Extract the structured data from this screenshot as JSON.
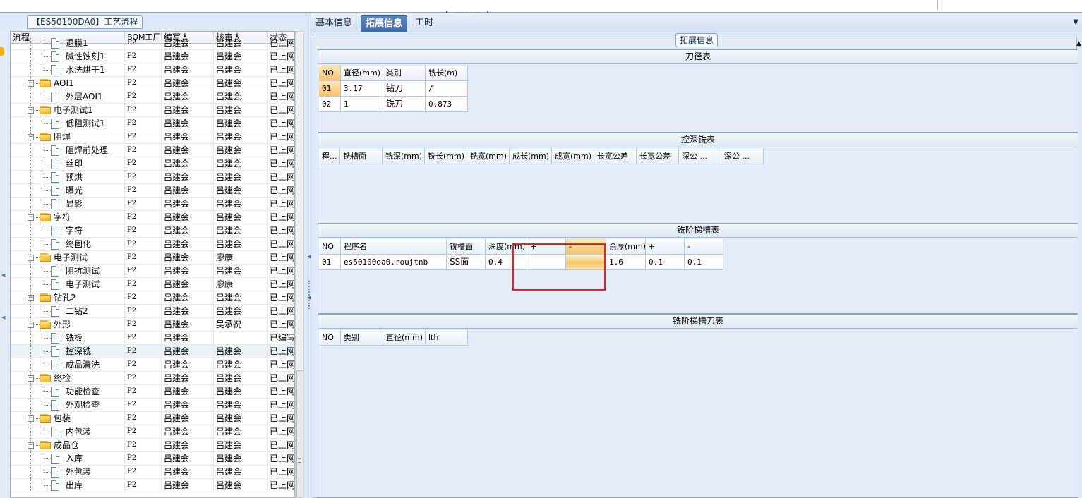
{
  "left_panel": {
    "title": "【ES50100DA0】工艺流程",
    "columns": [
      "流程",
      "BOM工厂",
      "编写人",
      "核审人",
      "状态"
    ],
    "rows": [
      {
        "level": 2,
        "type": "leaf",
        "name": "退膜1",
        "bom": "P2",
        "writer": "吕建会",
        "reviewer": "吕建会",
        "status": "已上网"
      },
      {
        "level": 2,
        "type": "leaf",
        "name": "碱性蚀刻1",
        "bom": "P2",
        "writer": "吕建会",
        "reviewer": "吕建会",
        "status": "已上网"
      },
      {
        "level": 2,
        "type": "leaf",
        "name": "水洗烘干1",
        "bom": "P2",
        "writer": "吕建会",
        "reviewer": "吕建会",
        "status": "已上网"
      },
      {
        "level": 1,
        "type": "folder",
        "name": "AOI1",
        "bom": "P2",
        "writer": "吕建会",
        "reviewer": "吕建会",
        "status": "已上网"
      },
      {
        "level": 2,
        "type": "leaf",
        "name": "外层AOI1",
        "bom": "P2",
        "writer": "吕建会",
        "reviewer": "吕建会",
        "status": "已上网"
      },
      {
        "level": 1,
        "type": "folder",
        "name": "电子测试1",
        "bom": "P2",
        "writer": "吕建会",
        "reviewer": "吕建会",
        "status": "已上网"
      },
      {
        "level": 2,
        "type": "leaf",
        "name": "低阻测试1",
        "bom": "P2",
        "writer": "吕建会",
        "reviewer": "吕建会",
        "status": "已上网"
      },
      {
        "level": 1,
        "type": "folder",
        "name": "阻焊",
        "bom": "P2",
        "writer": "吕建会",
        "reviewer": "吕建会",
        "status": "已上网"
      },
      {
        "level": 2,
        "type": "leaf",
        "name": "阻焊前处理",
        "bom": "P2",
        "writer": "吕建会",
        "reviewer": "吕建会",
        "status": "已上网"
      },
      {
        "level": 2,
        "type": "leaf",
        "name": "丝印",
        "bom": "P2",
        "writer": "吕建会",
        "reviewer": "吕建会",
        "status": "已上网"
      },
      {
        "level": 2,
        "type": "leaf",
        "name": "预烘",
        "bom": "P2",
        "writer": "吕建会",
        "reviewer": "吕建会",
        "status": "已上网"
      },
      {
        "level": 2,
        "type": "leaf",
        "name": "曝光",
        "bom": "P2",
        "writer": "吕建会",
        "reviewer": "吕建会",
        "status": "已上网"
      },
      {
        "level": 2,
        "type": "leaf",
        "name": "显影",
        "bom": "P2",
        "writer": "吕建会",
        "reviewer": "吕建会",
        "status": "已上网"
      },
      {
        "level": 1,
        "type": "folder",
        "name": "字符",
        "bom": "P2",
        "writer": "吕建会",
        "reviewer": "吕建会",
        "status": "已上网"
      },
      {
        "level": 2,
        "type": "leaf",
        "name": "字符",
        "bom": "P2",
        "writer": "吕建会",
        "reviewer": "吕建会",
        "status": "已上网"
      },
      {
        "level": 2,
        "type": "leaf",
        "name": "终固化",
        "bom": "P2",
        "writer": "吕建会",
        "reviewer": "吕建会",
        "status": "已上网"
      },
      {
        "level": 1,
        "type": "folder",
        "name": "电子测试",
        "bom": "P2",
        "writer": "吕建会",
        "reviewer": "廖康",
        "status": "已上网"
      },
      {
        "level": 2,
        "type": "leaf",
        "name": "阻抗测试",
        "bom": "P2",
        "writer": "吕建会",
        "reviewer": "吕建会",
        "status": "已上网"
      },
      {
        "level": 2,
        "type": "leaf",
        "name": "电子测试",
        "bom": "P2",
        "writer": "吕建会",
        "reviewer": "廖康",
        "status": "已上网"
      },
      {
        "level": 1,
        "type": "folder",
        "name": "钻孔2",
        "bom": "P2",
        "writer": "吕建会",
        "reviewer": "吕建会",
        "status": "已上网"
      },
      {
        "level": 2,
        "type": "leaf",
        "name": "二钻2",
        "bom": "P2",
        "writer": "吕建会",
        "reviewer": "吕建会",
        "status": "已上网"
      },
      {
        "level": 1,
        "type": "folder",
        "name": "外形",
        "bom": "P2",
        "writer": "吕建会",
        "reviewer": "吴承祝",
        "status": "已上网"
      },
      {
        "level": 2,
        "type": "leaf",
        "name": "铣板",
        "bom": "P2",
        "writer": "吕建会",
        "reviewer": "",
        "status": "已编写"
      },
      {
        "level": 2,
        "type": "leaf",
        "name": "控深铣",
        "bom": "P2",
        "writer": "吕建会",
        "reviewer": "吕建会",
        "status": "已上网",
        "selected": true
      },
      {
        "level": 2,
        "type": "leaf",
        "name": "成品清洗",
        "bom": "P2",
        "writer": "吕建会",
        "reviewer": "吕建会",
        "status": "已上网"
      },
      {
        "level": 1,
        "type": "folder",
        "name": "终检",
        "bom": "P2",
        "writer": "吕建会",
        "reviewer": "吕建会",
        "status": "已上网"
      },
      {
        "level": 2,
        "type": "leaf",
        "name": "功能检查",
        "bom": "P2",
        "writer": "吕建会",
        "reviewer": "吕建会",
        "status": "已上网"
      },
      {
        "level": 2,
        "type": "leaf",
        "name": "外观检查",
        "bom": "P2",
        "writer": "吕建会",
        "reviewer": "吕建会",
        "status": "已上网"
      },
      {
        "level": 1,
        "type": "folder",
        "name": "包装",
        "bom": "P2",
        "writer": "吕建会",
        "reviewer": "吕建会",
        "status": "已上网"
      },
      {
        "level": 2,
        "type": "leaf",
        "name": "内包装",
        "bom": "P2",
        "writer": "吕建会",
        "reviewer": "吕建会",
        "status": "已上网"
      },
      {
        "level": 1,
        "type": "folder",
        "name": "成品仓",
        "bom": "P2",
        "writer": "吕建会",
        "reviewer": "吕建会",
        "status": "已上网"
      },
      {
        "level": 2,
        "type": "leaf",
        "name": "入库",
        "bom": "P2",
        "writer": "吕建会",
        "reviewer": "吕建会",
        "status": "已上网"
      },
      {
        "level": 2,
        "type": "leaf",
        "name": "外包装",
        "bom": "P2",
        "writer": "吕建会",
        "reviewer": "吕建会",
        "status": "已上网"
      },
      {
        "level": 2,
        "type": "leaf",
        "name": "出库",
        "bom": "P2",
        "writer": "吕建会",
        "reviewer": "吕建会",
        "status": "已上网"
      }
    ]
  },
  "tabs": [
    {
      "label": "基本信息",
      "active": false
    },
    {
      "label": "拓展信息",
      "active": true
    },
    {
      "label": "工时",
      "active": false
    }
  ],
  "group_caption": "拓展信息",
  "sections": {
    "tool_diameter": {
      "title": "刀径表",
      "columns": [
        "NO",
        "直径(mm)",
        "类别",
        "铣长(m)"
      ],
      "rows": [
        [
          "01",
          "3.17",
          "钻刀",
          "/"
        ],
        [
          "02",
          "1",
          "铣刀",
          "0.873"
        ]
      ]
    },
    "depth_milling": {
      "title": "控深铣表",
      "columns": [
        "程...",
        "铣槽面",
        "铣深(mm)",
        "铣长(mm)",
        "铣宽(mm)",
        "成长(mm)",
        "成宽(mm)",
        "长宽公差",
        "长宽公差",
        "深公 ...",
        "深公 ..."
      ]
    },
    "step_slot": {
      "title": "铣阶梯槽表",
      "columns": [
        "NO",
        "程序名",
        "铣槽面",
        "深度(mm)",
        "+",
        "-",
        "余厚(mm)",
        "+",
        "-"
      ],
      "rows": [
        [
          "01",
          "es50100da0.roujtnb",
          "SS面",
          "0.4",
          "",
          "",
          "1.6",
          "0.1",
          "0.1"
        ]
      ]
    },
    "step_slot_tool": {
      "title": "铣阶梯槽刀表",
      "columns": [
        "NO",
        "类别",
        "直径(mm)",
        "lth"
      ]
    }
  },
  "colors": {
    "panel_bg": "#dfe8f6",
    "active_tab": "#4a72b2",
    "highlight_border": "#e0261e",
    "selected_cell": "#f6c36a"
  }
}
